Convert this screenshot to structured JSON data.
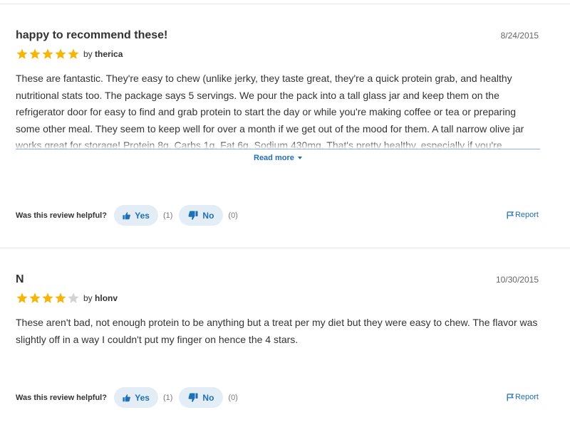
{
  "reviews": [
    {
      "title": "happy to recommend these!",
      "date": "8/24/2015",
      "rating": 5,
      "by_prefix": "by",
      "author": "therica",
      "text": "These are fantastic. They're easy to chew (unlike jerky, they taste great, they're a quick protein grab, and healthy nutritional stats too. The package says 5 servings. We pour the pack into a tall glass jar and keep them on the refrigerator door for easy to find and grab protein to start the day or while you're making coffee or tea or preparing some other meal. They seem to keep well for over a month if we get out of the mood for them. A tall narrow olive jar works great for storage! Protein 8g, Carbs 1g, Fat 6g, Sodium 430mg. That's pretty healthy, especially if you're Diabetic or need to reduce Carbohydrate intake. The only",
      "read_more": "Read more",
      "helpful_label": "Was this review helpful?",
      "yes_label": "Yes",
      "yes_count": "(1)",
      "no_label": "No",
      "no_count": "(0)",
      "report_label": "Report"
    },
    {
      "title": "N",
      "date": "10/30/2015",
      "rating": 4,
      "by_prefix": "by",
      "author": "hlonv",
      "text": "These aren't bad, not enough protein to be anything but a treat per my diet but they were easy to chew. The flavor was slightly off in a way I couldn't put my finger on hence the 4 stars.",
      "helpful_label": "Was this review helpful?",
      "yes_label": "Yes",
      "yes_count": "(1)",
      "no_label": "No",
      "no_count": "(0)",
      "report_label": "Report"
    }
  ],
  "colors": {
    "star_filled": "#f5b50a",
    "star_empty": "#d3d3d3",
    "accent": "#1f6fb5",
    "vote_bg": "#e2edf5"
  },
  "icons": {
    "star": "star-icon",
    "thumbs_up": "thumbs-up-icon",
    "thumbs_down": "thumbs-down-icon",
    "flag": "flag-icon",
    "caret": "chevron-down-icon"
  }
}
